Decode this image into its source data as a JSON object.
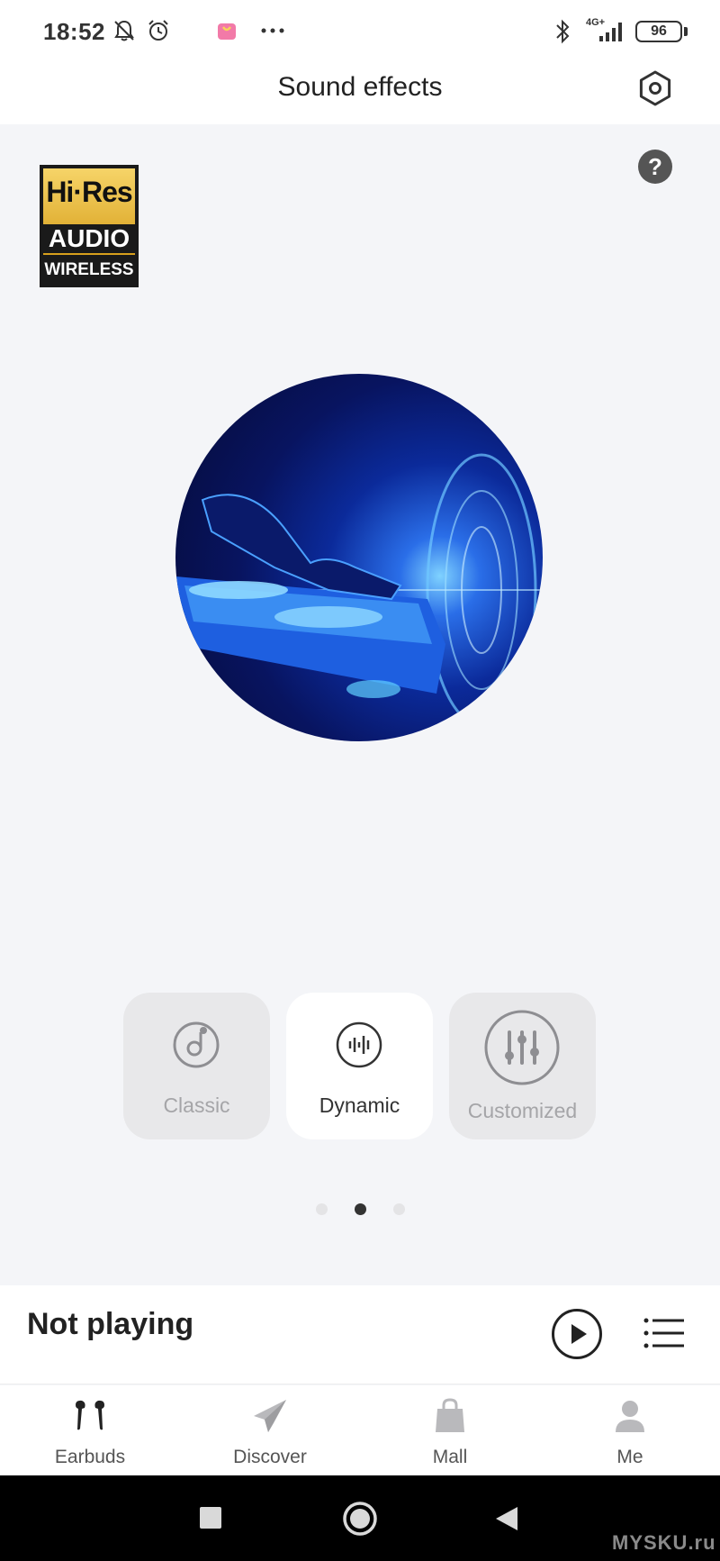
{
  "status_bar": {
    "time": "18:52",
    "network": "4G+",
    "battery": "96",
    "icons": [
      "bell-off-icon",
      "alarm-icon",
      "shopping-bag-app-icon",
      "more-dots-icon",
      "bluetooth-icon",
      "signal-icon",
      "battery-icon"
    ]
  },
  "header": {
    "title": "Sound effects",
    "settings_icon": "settings-hexagon-icon"
  },
  "help_icon": "help-icon",
  "badge": {
    "line1": "Hi·Res",
    "line2": "AUDIO",
    "line3": "WIRELESS"
  },
  "artwork": {
    "description_icon": "dj-turntable-artwork"
  },
  "modes": [
    {
      "label": "Classic",
      "icon": "music-note-icon",
      "active": false
    },
    {
      "label": "Dynamic",
      "icon": "waveform-icon",
      "active": true
    },
    {
      "label": "Customized",
      "icon": "equalizer-icon",
      "active": false
    }
  ],
  "pager": {
    "count": 3,
    "active_index": 1
  },
  "player": {
    "status": "Not playing",
    "play_icon": "play-icon",
    "playlist_icon": "playlist-icon"
  },
  "tabs": [
    {
      "label": "Earbuds",
      "icon": "earbuds-icon"
    },
    {
      "label": "Discover",
      "icon": "paper-plane-icon"
    },
    {
      "label": "Mall",
      "icon": "shopping-bag-icon"
    },
    {
      "label": "Me",
      "icon": "person-icon"
    }
  ],
  "system_nav": [
    "recents-square-icon",
    "home-circle-icon",
    "back-triangle-icon"
  ],
  "watermark": "MYSKU.ru",
  "colors": {
    "background": "#f4f5f8",
    "card_inactive": "#e8e8ea",
    "card_active": "#ffffff",
    "text_dark": "#222222",
    "text_muted": "#a5a5a8"
  }
}
